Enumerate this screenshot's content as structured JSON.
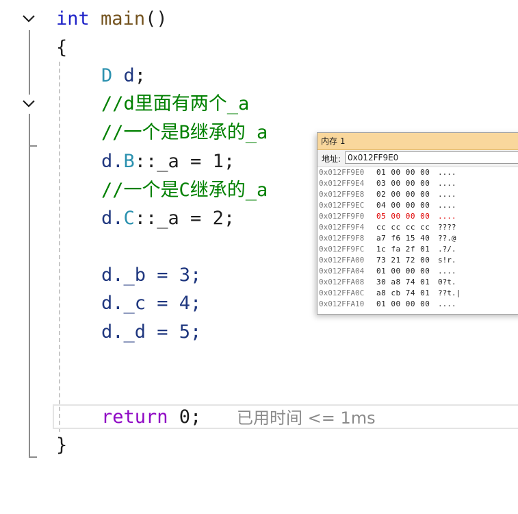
{
  "editor": {
    "lines": {
      "l1": {
        "kw": "int",
        "fn": "main",
        "punc": "()"
      },
      "l2": {
        "punc": "{"
      },
      "l3": {
        "cls": "D",
        "id": "d",
        "punc": ";"
      },
      "l4": {
        "cmt": "//d里面有两个_a"
      },
      "l5": {
        "cmt": "//一个是B继承的_a"
      },
      "l6": {
        "id": "d.",
        "cls": "B",
        "rest": "::_a = 1;"
      },
      "l7": {
        "cmt": "//一个是C继承的_a"
      },
      "l8": {
        "id": "d.",
        "cls": "C",
        "rest": "::_a = 2;"
      },
      "l9": {
        "text": "d._b = 3;"
      },
      "l10": {
        "text": "d._c = 4;"
      },
      "l11": {
        "text": "d._d = 5;"
      },
      "l12": {
        "kw": "return",
        "rest": " 0;"
      },
      "l13": {
        "punc": "}"
      }
    },
    "perf_hint": "已用时间 <= 1ms"
  },
  "memory_window": {
    "title": "内存 1",
    "address_label": "地址:",
    "address_value": "0x012FF9E0",
    "rows": [
      {
        "addr": "0x012FF9E0",
        "bytes": "01 00 00 00",
        "ascii": "....",
        "changed": false
      },
      {
        "addr": "0x012FF9E4",
        "bytes": "03 00 00 00",
        "ascii": "....",
        "changed": false
      },
      {
        "addr": "0x012FF9E8",
        "bytes": "02 00 00 00",
        "ascii": "....",
        "changed": false
      },
      {
        "addr": "0x012FF9EC",
        "bytes": "04 00 00 00",
        "ascii": "....",
        "changed": false
      },
      {
        "addr": "0x012FF9F0",
        "bytes": "05 00 00 00",
        "ascii": "....",
        "changed": true
      },
      {
        "addr": "0x012FF9F4",
        "bytes": "cc cc cc cc",
        "ascii": "????",
        "changed": false
      },
      {
        "addr": "0x012FF9F8",
        "bytes": "a7 f6 15 40",
        "ascii": "??.@",
        "changed": false
      },
      {
        "addr": "0x012FF9FC",
        "bytes": "1c fa 2f 01",
        "ascii": ".?/.",
        "changed": false
      },
      {
        "addr": "0x012FFA00",
        "bytes": "73 21 72 00",
        "ascii": "s!r.",
        "changed": false
      },
      {
        "addr": "0x012FFA04",
        "bytes": "01 00 00 00",
        "ascii": "....",
        "changed": false
      },
      {
        "addr": "0x012FFA08",
        "bytes": "30 a8 74 01",
        "ascii": "0?t.",
        "changed": false
      },
      {
        "addr": "0x012FFA0C",
        "bytes": "a8 cb 74 01",
        "ascii": "??t.|",
        "changed": false
      },
      {
        "addr": "0x012FFA10",
        "bytes": "01 00 00 00",
        "ascii": "....",
        "changed": false
      }
    ]
  },
  "colors": {
    "keyword": "#1f23c8",
    "class": "#2b91af",
    "comment": "#008000",
    "return_kw": "#8f08c4",
    "changed_byte": "#e00000",
    "mem_title_bg": "#f9d79c"
  }
}
